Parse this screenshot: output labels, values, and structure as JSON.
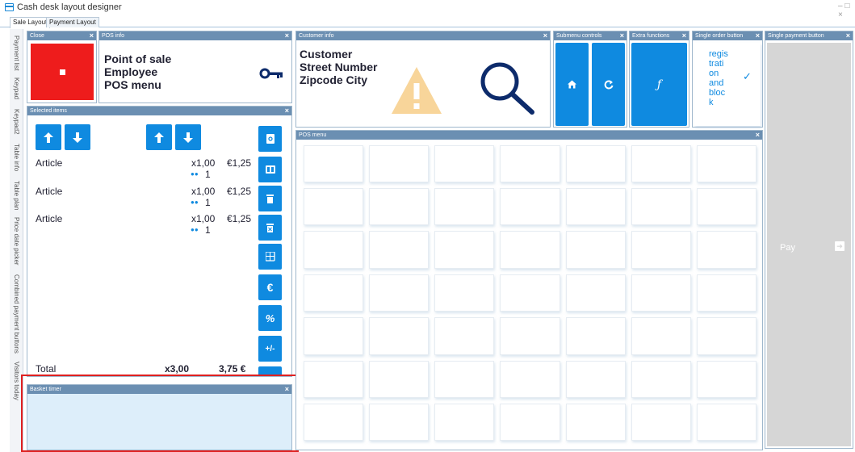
{
  "window": {
    "title": "Cash desk layout designer",
    "controls": "– □ ×"
  },
  "tabs": [
    {
      "label": "Sale Layout",
      "active": true
    },
    {
      "label": "Payment Layout",
      "active": false
    }
  ],
  "side_tabs": [
    "Payment list",
    "Keypad",
    "Keypad2",
    "Table info",
    "Table plan",
    "Price date picker",
    "Combined payment buttons",
    "Visitors today"
  ],
  "panels": {
    "close": {
      "title": "Close",
      "close_label": "×",
      "color": "#ee1c1c"
    },
    "pos_info": {
      "title": "POS info",
      "close_label": "×",
      "lines": [
        "Point of sale",
        "Employee",
        "POS menu"
      ],
      "icon": "key-icon"
    },
    "customer_info": {
      "title": "Customer info",
      "close_label": "×",
      "lines": [
        "Customer",
        "Street Number",
        "Zipcode City"
      ],
      "warning_icon": "warning-icon",
      "search_icon": "search-icon"
    },
    "submenu_controls": {
      "title": "Submenu controls",
      "close_label": "×",
      "buttons": [
        "home-icon",
        "refresh-icon"
      ]
    },
    "extra_functions": {
      "title": "Extra functions",
      "close_label": "×",
      "button_glyph": "ƒ"
    },
    "single_order_button": {
      "title": "Single order button",
      "close_label": "×",
      "lines": [
        "regis",
        "trati",
        "on",
        "and",
        "bloc",
        "k"
      ],
      "check_glyph": "✓"
    },
    "single_payment_button": {
      "title": "Single payment button",
      "close_label": "×",
      "label": "Pay",
      "arrow": "➔"
    },
    "selected_items": {
      "title": "Selected items",
      "close_label": "×",
      "items": [
        {
          "name": "Article",
          "qty": "x1,00",
          "price": "€1,25",
          "persons": "1"
        },
        {
          "name": "Article",
          "qty": "x1,00",
          "price": "€1,25",
          "persons": "1"
        },
        {
          "name": "Article",
          "qty": "x1,00",
          "price": "€1,25",
          "persons": "1"
        }
      ],
      "total_label": "Total",
      "total_qty": "x3,00",
      "total_amount": "3,75 €",
      "side_buttons": [
        "search-document-icon",
        "split-icon",
        "delete-icon",
        "delete-all-icon",
        "calculator-icon",
        "euro-icon",
        "percent-icon",
        "plus-minus-icon"
      ],
      "side_glyphs": [
        "",
        "",
        "",
        "",
        "",
        "€",
        "%",
        "+/-"
      ]
    },
    "pos_menu": {
      "title": "POS menu",
      "close_label": "×",
      "rows": 7,
      "cols": 7
    },
    "basket_timer": {
      "title": "Basket timer",
      "close_label": "×"
    }
  },
  "colors": {
    "accent": "#0f8ae0",
    "header": "#6b8fb2",
    "light_panel": "#ddeefa",
    "highlight": "#e02020",
    "warning": "#f8d59a",
    "search": "#0d2b6b"
  }
}
